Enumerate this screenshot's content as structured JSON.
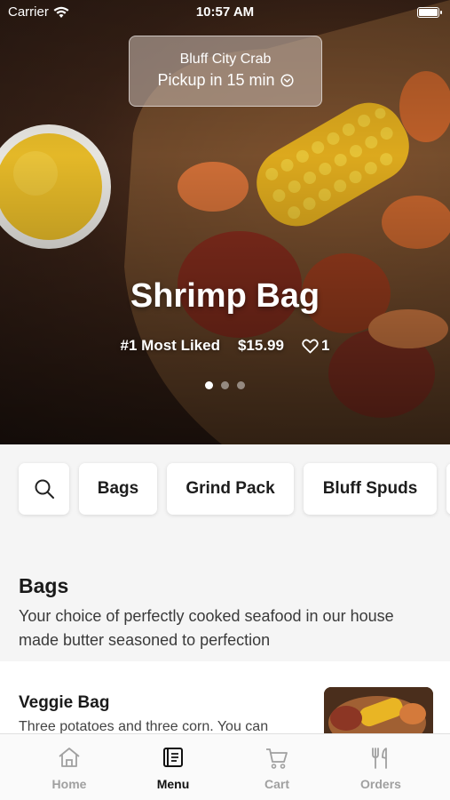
{
  "status_bar": {
    "carrier": "Carrier",
    "time": "10:57 AM"
  },
  "location": {
    "name": "Bluff City Crab",
    "pickup": "Pickup in 15 min"
  },
  "hero": {
    "title": "Shrimp Bag",
    "badge": "#1 Most Liked",
    "price": "$15.99",
    "likes": "1",
    "page_count": 3,
    "active_page": 0
  },
  "chips": {
    "items": [
      "Bags",
      "Grind Pack",
      "Bluff Spuds"
    ]
  },
  "section": {
    "title": "Bags",
    "description": "Your choice of perfectly cooked seafood in our house made butter seasoned to perfection"
  },
  "menu_item": {
    "name": "Veggie Bag",
    "description": "Three potatoes and three corn. You can"
  },
  "tabs": [
    {
      "label": "Home",
      "icon": "home-icon",
      "active": false
    },
    {
      "label": "Menu",
      "icon": "menu-icon",
      "active": true
    },
    {
      "label": "Cart",
      "icon": "cart-icon",
      "active": false
    },
    {
      "label": "Orders",
      "icon": "fork-knife-icon",
      "active": false
    }
  ],
  "colors": {
    "active_tab": "#111111",
    "inactive_tab": "#a0a0a0",
    "background": "#f5f5f5"
  }
}
